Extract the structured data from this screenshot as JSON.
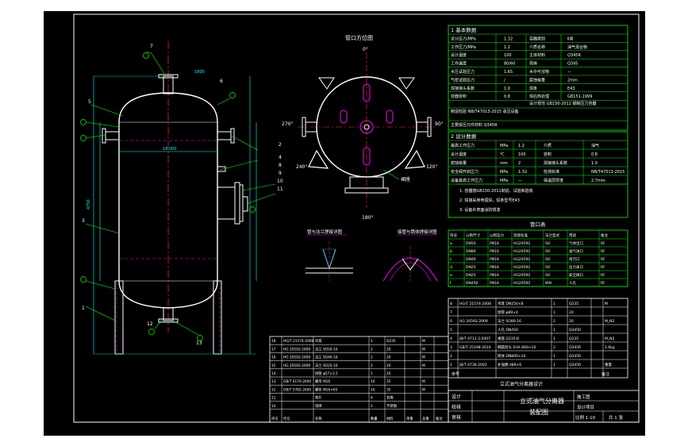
{
  "drawing": {
    "title_cn": "立式油气分离器",
    "subtitle_cn": "装配图",
    "project_line": "立式油气分离器设计",
    "section_view_title": "管口方位图",
    "weld_detail_1": "管与法兰焊接详图",
    "weld_detail_2": "接管与筒体焊接详图",
    "sheet_label": "共 1 张",
    "scale_label": "比例 1:10"
  },
  "section_view": {
    "top_angle": "0°",
    "left_angle": "270°",
    "right_angle": "90°",
    "lower_left_angle": "240°",
    "lower_right_angle": "120°",
    "bottom_angle": "180°",
    "callout": "裙座"
  },
  "elevation": {
    "dimension_top": "1800",
    "dimension_mid": "18,000",
    "dimension_left_overall": "4750",
    "callouts": [
      "1",
      "2",
      "3",
      "4",
      "5",
      "6",
      "7",
      "8",
      "9",
      "10",
      "11",
      "12",
      "13"
    ]
  },
  "tech_data": {
    "header": "1 基本数据",
    "rows": [
      {
        "label": "设计压力/MPa",
        "value": "1.32",
        "label2": "容器类别",
        "value2": "Ⅱ类"
      },
      {
        "label": "工作压力/MPa",
        "value": "1.2",
        "label2": "介质名称",
        "value2": "油气混合物"
      },
      {
        "label": "设计温度",
        "value": "100",
        "label2": "主体材料",
        "value2": "Q345R"
      },
      {
        "label": "工作温度",
        "value": "80/60",
        "label2": "壳体",
        "value2": "Q345"
      },
      {
        "label": "水压试验压力",
        "value": "1.65",
        "label2": "水中可溶物",
        "value2": "—"
      },
      {
        "label": "气密试验压力",
        "value": "/",
        "label2": "腐蚀裕量",
        "value2": "2mm"
      },
      {
        "label": "焊接接头系数",
        "value": "1.0",
        "label2": "焊条",
        "value2": "E43"
      },
      {
        "label": "容器容积",
        "value": "0.8",
        "label2": "焊后热处理",
        "value2": "GB151-1999"
      }
    ],
    "notes": [
      "设计规范 GB150-2011 钢制压力容器",
      "制造检验 NB/T47013-2015 承压设备",
      "主要受压元件材料 Q345R"
    ]
  },
  "design_data": {
    "header": "2 设计数据",
    "rows": [
      {
        "label": "最高工作压力",
        "unit": "MPa",
        "value": "1.2",
        "label2": "介质",
        "value2": "油气"
      },
      {
        "label": "设计温度",
        "unit": "℃",
        "value": "100",
        "label2": "容积",
        "value2": "0.8"
      },
      {
        "label": "腐蚀裕量",
        "unit": "mm",
        "value": "2",
        "label2": "焊接接头系数",
        "value2": "1.0"
      },
      {
        "label": "安全阀开启压力",
        "unit": "MPa",
        "value": "1.32",
        "label2": "检测标准",
        "value2": "NB/T47013-2015"
      },
      {
        "label": "设备最高工作压力",
        "unit": "MPa",
        "value": "—",
        "label2": "保温层厚度",
        "value2": "2.7mm"
      }
    ],
    "requirements": [
      "1. 容器按GB150-2011制造、试验和验收",
      "2. 焊接采用电弧焊，焊条型号E43",
      "3. 设备外表面涂防锈漆"
    ]
  },
  "nozzle_table": {
    "header": "管口表",
    "columns": [
      "符号",
      "公称尺寸",
      "公称压力",
      "连接标准",
      "法兰型式",
      "用途",
      "备注"
    ],
    "rows": [
      [
        "a",
        "DN50",
        "PN16",
        "HG20592",
        "SO",
        "气体出口",
        "RF"
      ],
      [
        "b",
        "DN80",
        "PN16",
        "HG20592",
        "SO",
        "油气进口",
        "RF"
      ],
      [
        "c",
        "DN40",
        "PN16",
        "HG20592",
        "SO",
        "排污口",
        "RF"
      ],
      [
        "d",
        "DN25",
        "PN16",
        "HG20592",
        "SO",
        "压力表口",
        "RF"
      ],
      [
        "e",
        "DN25",
        "PN16",
        "HG20592",
        "SO",
        "安全阀口",
        "RF"
      ],
      [
        "f",
        "DN450",
        "PN16",
        "HG20592",
        "WN",
        "人孔",
        "RF"
      ]
    ]
  },
  "parts_list_right": {
    "rows": [
      [
        "8",
        "HG/T 21574-2008",
        "吊耳 DN250×8",
        "1",
        "Q235",
        "",
        "M"
      ],
      [
        "7",
        "",
        "接管 φ89×4",
        "1",
        "20",
        "",
        ""
      ],
      [
        "6",
        "HG 20592-2009",
        "法兰 SO80-16",
        "2",
        "20",
        "",
        "M_N2"
      ],
      [
        "5",
        "",
        "人孔 DN450",
        "1",
        "Q345R",
        "",
        ""
      ],
      [
        "4",
        "JB/T 4712.3-2007",
        "裙座 Q235-B",
        "1",
        "Q235",
        "",
        "M_N2"
      ],
      [
        "3",
        "GB/T 25198-2010",
        "椭圆封头 EHA 800×10",
        "2",
        "Q345R",
        "",
        "1.6kg"
      ],
      [
        "2",
        "",
        "筒体 DN800×10",
        "1",
        "Q345R",
        "",
        ""
      ],
      [
        "1",
        "JB/T 4736-2002",
        "补强圈 d89×6",
        "1",
        "Q345R",
        "",
        "重量"
      ]
    ],
    "footer_left": "序号",
    "footer_right": "备注"
  },
  "parts_list_left": {
    "rows": [
      [
        "18",
        "HG/T 21574-2008",
        "吊耳",
        "1",
        "Q235",
        "",
        "M"
      ],
      [
        "17",
        "HG 20592-2009",
        "法兰 SO50-16",
        "2",
        "20",
        "",
        "M"
      ],
      [
        "16",
        "HG 20592-2009",
        "法兰 SO40-16",
        "2",
        "20",
        "",
        "M"
      ],
      [
        "15",
        "HG 20592-2009",
        "法兰 SO25-16",
        "2",
        "20",
        "",
        "M"
      ],
      [
        "14",
        "",
        "接管 φ57×3.5",
        "1",
        "20",
        "",
        ""
      ],
      [
        "13",
        "GB/T 6170-2000",
        "螺母 M16",
        "16",
        "35",
        "",
        "M"
      ],
      [
        "12",
        "GB/T 5782-2000",
        "螺栓 M16×65",
        "16",
        "35",
        "",
        "M"
      ],
      [
        "11",
        "",
        "垫片",
        "4",
        "石棉",
        "",
        ""
      ],
      [
        "10",
        "",
        "铭牌",
        "1",
        "不锈钢",
        "",
        ""
      ]
    ],
    "footer": [
      "序号",
      "代号",
      "名称",
      "数量",
      "材料",
      "单重",
      "总重",
      "备注"
    ]
  },
  "title_block": {
    "labels": [
      "设计",
      "校核",
      "审核"
    ],
    "label_right": [
      "比例",
      "重量"
    ],
    "stage": "施工图",
    "design_project": "设计项目"
  },
  "colors": {
    "background": "#000000",
    "frame": "#ffffff",
    "outline": "#ffffff",
    "table": "#00ff00",
    "dimension": "#00ffff",
    "centerline": "#ff3030",
    "accent": "#ff00ff",
    "hatch": "#00a0ff"
  }
}
